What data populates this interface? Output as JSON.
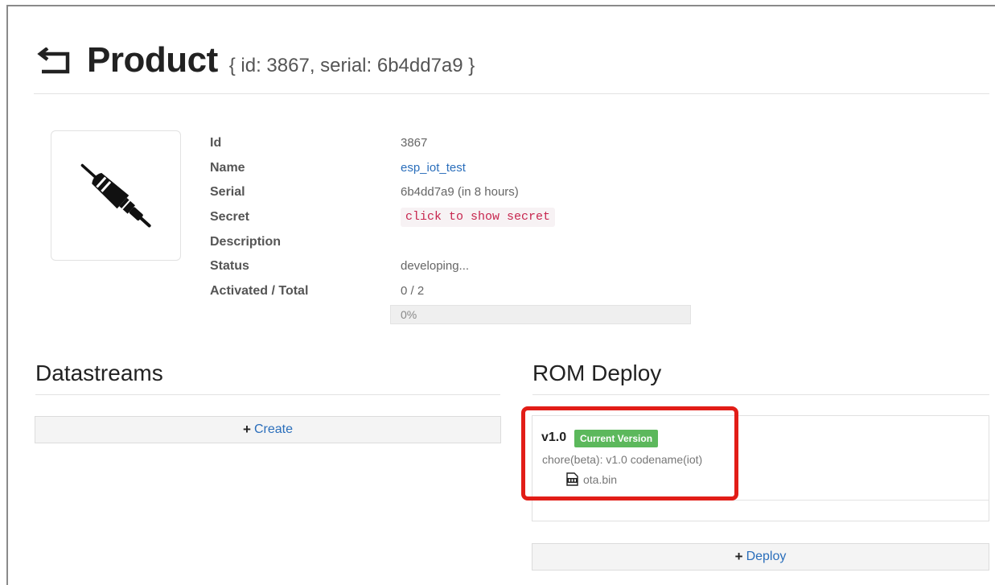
{
  "header": {
    "title": "Product",
    "subtitle": "{ id: 3867, serial: 6b4dd7a9 }"
  },
  "details": {
    "id_label": "Id",
    "id_value": "3867",
    "name_label": "Name",
    "name_value": "esp_iot_test",
    "serial_label": "Serial",
    "serial_value": "6b4dd7a9 (in 8 hours)",
    "secret_label": "Secret",
    "secret_value": "click to show secret",
    "description_label": "Description",
    "status_label": "Status",
    "status_value": "developing...",
    "activated_label": "Activated / Total",
    "activated_value": "0 / 2",
    "progress_text": "0%",
    "progress_fraction": 0
  },
  "datastreams": {
    "title": "Datastreams",
    "create_plus": "+",
    "create_label": "Create"
  },
  "rom_deploy": {
    "title": "ROM Deploy",
    "version": "v1.0",
    "badge": "Current Version",
    "description": "chore(beta): v1.0 codename(iot)",
    "file_name": "ota.bin",
    "deploy_plus": "+",
    "deploy_label": "Deploy"
  },
  "icons": {
    "back": "back-arrow-icon",
    "product": "plug-connector-icon",
    "file": "file-icon"
  },
  "colors": {
    "link": "#2a6ebb",
    "badge": "#5cb85c",
    "highlight": "#e21d17",
    "secret_text": "#c7254e"
  }
}
